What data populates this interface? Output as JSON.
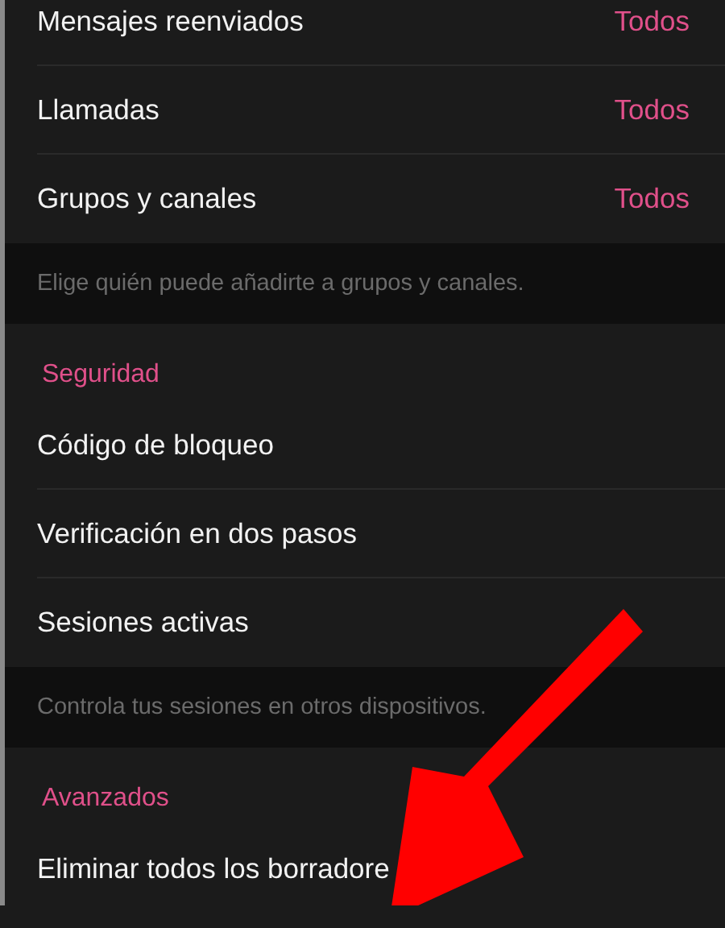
{
  "sections": [
    {
      "kind": "rows",
      "rows": [
        {
          "label": "Mensajes reenviados",
          "value": "Todos"
        },
        {
          "label": "Llamadas",
          "value": "Todos"
        },
        {
          "label": "Grupos y canales",
          "value": "Todos"
        }
      ]
    },
    {
      "kind": "hint",
      "text": "Elige quién puede añadirte a grupos y canales."
    },
    {
      "kind": "rows",
      "header": "Seguridad",
      "rows": [
        {
          "label": "Código de bloqueo"
        },
        {
          "label": "Verificación en dos pasos"
        },
        {
          "label": "Sesiones activas"
        }
      ]
    },
    {
      "kind": "hint",
      "text": "Controla tus sesiones en otros dispositivos."
    },
    {
      "kind": "rows",
      "header": "Avanzados",
      "rows": [
        {
          "label": "Eliminar todos los borradore"
        }
      ]
    }
  ]
}
